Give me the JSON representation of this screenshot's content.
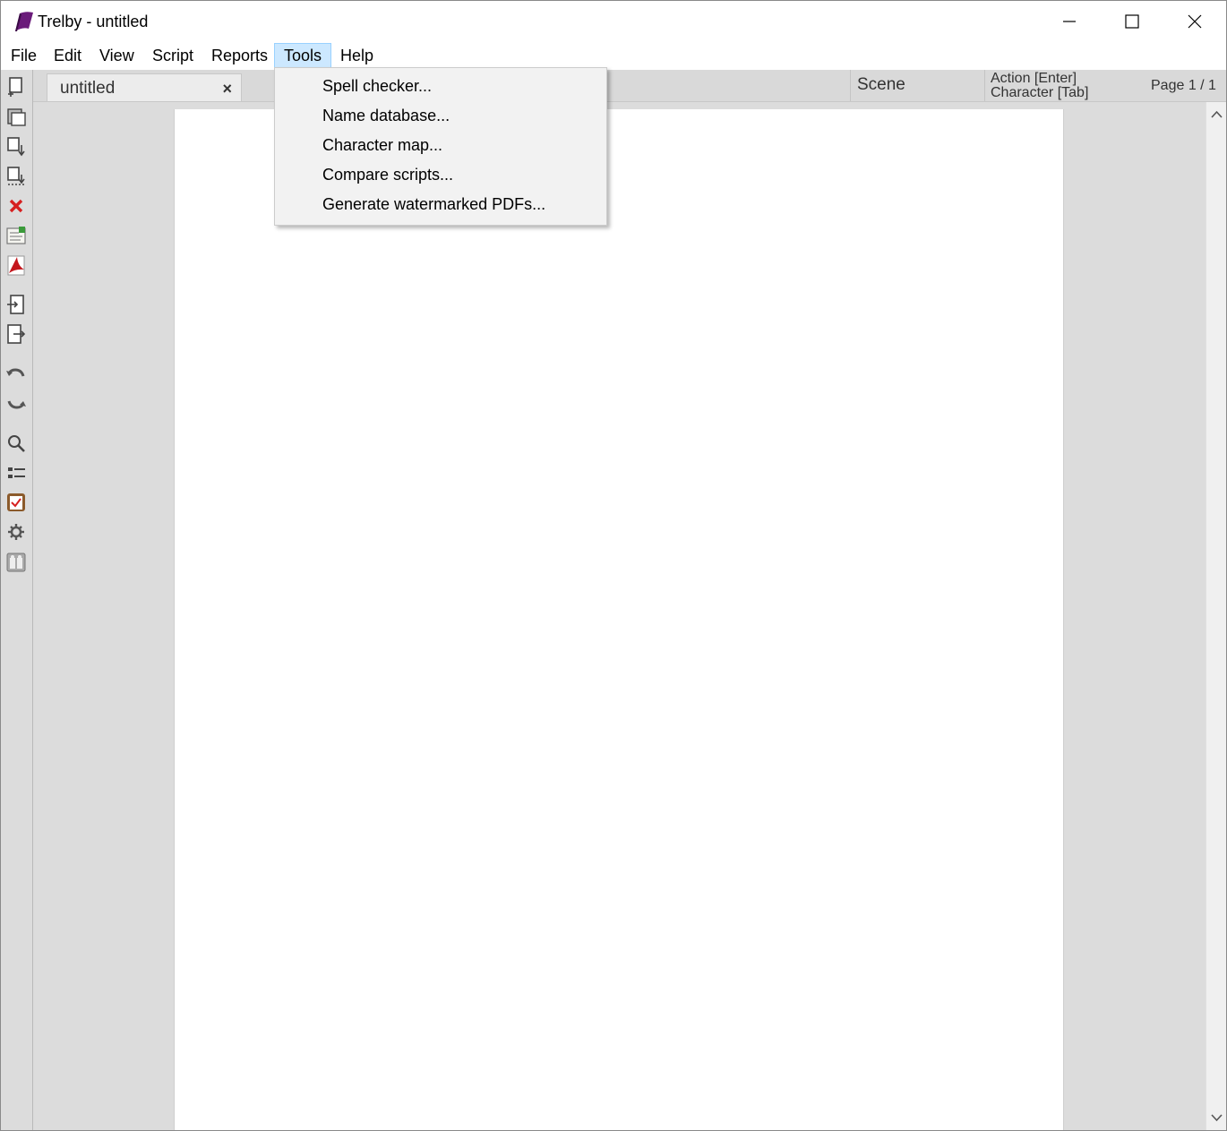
{
  "window": {
    "title": "Trelby - untitled",
    "controls": [
      "minimize-icon",
      "maximize-icon",
      "close-icon"
    ]
  },
  "menubar": {
    "items": [
      {
        "label": "File"
      },
      {
        "label": "Edit"
      },
      {
        "label": "View"
      },
      {
        "label": "Script"
      },
      {
        "label": "Reports"
      },
      {
        "label": "Tools",
        "active": true
      },
      {
        "label": "Help"
      }
    ]
  },
  "tools_menu": {
    "items": [
      {
        "label": "Spell checker..."
      },
      {
        "label": "Name database..."
      },
      {
        "label": "Character map..."
      },
      {
        "label": "Compare scripts..."
      },
      {
        "label": "Generate watermarked PDFs..."
      }
    ]
  },
  "toolbar": {
    "icons": [
      "new-script-icon",
      "open-icon",
      "save-icon",
      "save-as-icon",
      "close-script-icon",
      "import-icon",
      "export-pdf-icon",
      "import-text-icon",
      "export-text-icon",
      "undo-icon",
      "redo-icon",
      "find-icon",
      "navigate-icon",
      "check-script-icon",
      "settings-icon",
      "characters-icon"
    ]
  },
  "tabs": [
    {
      "label": "untitled",
      "close_glyph": "×"
    }
  ],
  "status": {
    "scene": "Scene",
    "action_hint": "Action [Enter]",
    "character_hint": "Character [Tab]",
    "page": "Page 1 / 1"
  },
  "colors": {
    "app_icon": "#6a1b7a",
    "menu_highlight": "#cce8ff",
    "close_script_icon": "#d62020",
    "pdf_icon": "#c4161c"
  }
}
